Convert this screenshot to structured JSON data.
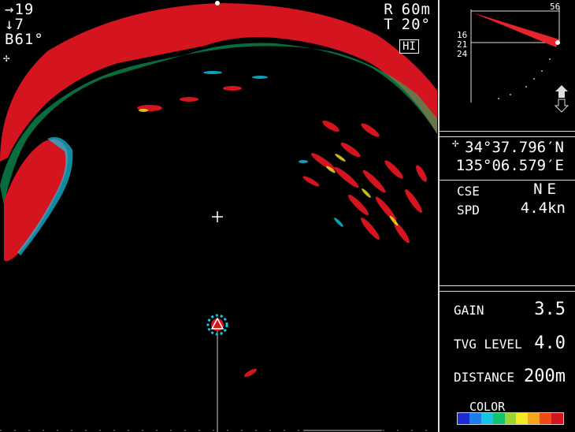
{
  "hud_left": {
    "bearing": "→19",
    "depth": "↓7",
    "tilt": "B61°",
    "cursor": "✢"
  },
  "hud_right": {
    "range_label": "R",
    "range_value": "60m",
    "tilt_label": "T",
    "tilt_value": "20°",
    "mode_badge": "HI"
  },
  "mini_scale": {
    "top": "56",
    "marks": [
      "16",
      "21",
      "24"
    ]
  },
  "position": {
    "lat": "34°37.796′N",
    "lon": "135°06.579′E",
    "icon": "✢"
  },
  "nav": {
    "cse_label": "CSE",
    "cse_value": "NE",
    "spd_label": "SPD",
    "spd_value": "4.4kn"
  },
  "settings": {
    "gain_label": "GAIN",
    "gain_value": "3.5",
    "tvg_label": "TVG LEVEL",
    "tvg_value": "4.0",
    "distance_label": "DISTANCE",
    "distance_value": "200m",
    "color_label": "COLOR"
  },
  "color_scale": [
    "#1d2bd0",
    "#1f7dea",
    "#16c4e5",
    "#13c26e",
    "#9bd42c",
    "#f3ea25",
    "#f6a51c",
    "#ee4a17",
    "#d4141e"
  ],
  "colors": {
    "echo_strong": "#d4141e",
    "echo_mid": "#f3ea25",
    "echo_weak": "#16c4e5",
    "echo_faint": "#1f7dea"
  }
}
